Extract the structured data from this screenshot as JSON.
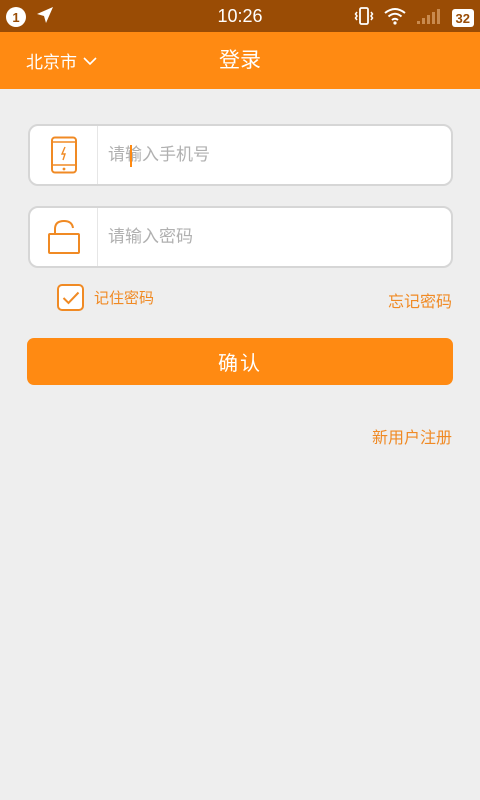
{
  "status_bar": {
    "notification_count": "1",
    "time": "10:26",
    "battery": "32",
    "icons": [
      "location-arrow-icon",
      "vibrate-icon",
      "wifi-icon",
      "signal-icon",
      "battery-icon"
    ]
  },
  "header": {
    "city": "北京市",
    "title": "登录"
  },
  "form": {
    "phone_placeholder": "请输入手机号",
    "password_placeholder": "请输入密码",
    "remember_label": "记住密码",
    "remember_checked": true,
    "forgot_label": "忘记密码",
    "confirm_label": "确认",
    "register_label": "新用户注册"
  },
  "colors": {
    "accent": "#ff8a12",
    "status_bar": "#9a4c05",
    "link": "#f08a24",
    "background": "#eeeeee"
  }
}
